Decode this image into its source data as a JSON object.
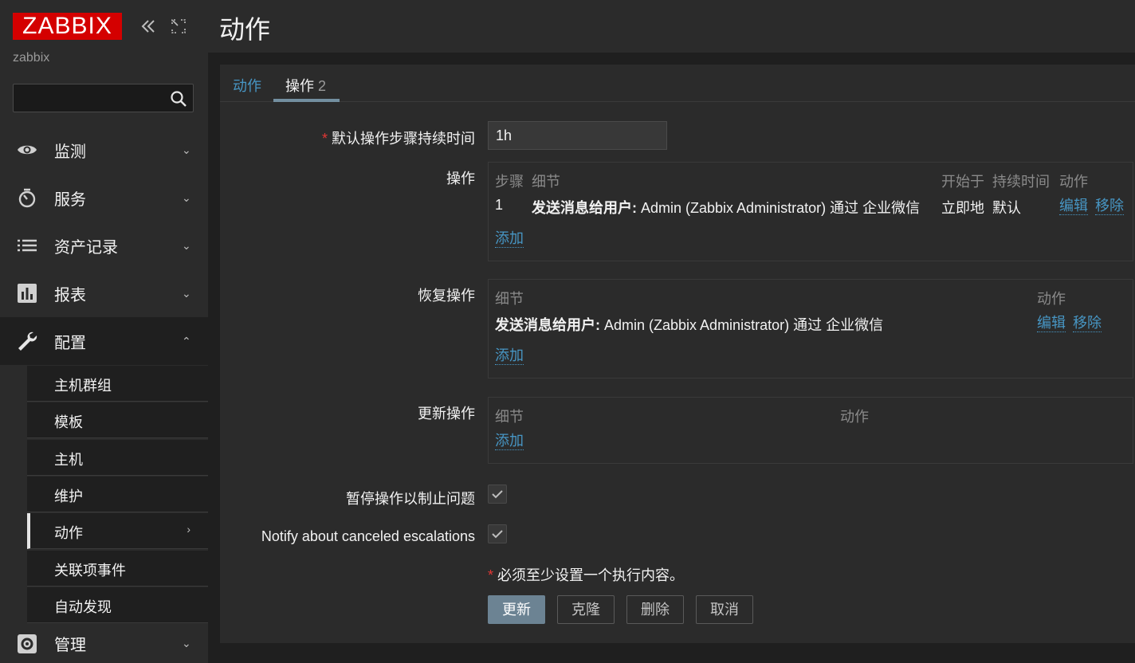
{
  "sidebar": {
    "logo": "ZABBIX",
    "server_name": "zabbix",
    "collapse_icon": "double-chevron-left-icon",
    "kiosk_icon": "expand-icon",
    "search": {
      "value": "",
      "placeholder": ""
    },
    "nav": [
      {
        "label": "监测",
        "icon": "eye-icon"
      },
      {
        "label": "服务",
        "icon": "stopwatch-icon"
      },
      {
        "label": "资产记录",
        "icon": "list-icon"
      },
      {
        "label": "报表",
        "icon": "bar-chart-icon"
      },
      {
        "label": "配置",
        "icon": "wrench-icon"
      },
      {
        "label": "管理",
        "icon": "gear-icon"
      }
    ],
    "config_sub": [
      "主机群组",
      "模板",
      "主机",
      "维护",
      "动作",
      "关联项事件",
      "自动发现"
    ]
  },
  "header": {
    "title": "动作"
  },
  "tabs": [
    {
      "label": "动作"
    },
    {
      "label": "操作",
      "count": "2"
    }
  ],
  "form": {
    "step_duration": {
      "label": "默认操作步骤持续时间",
      "value": "1h"
    },
    "operations": {
      "label": "操作",
      "headers": [
        "步骤",
        "细节",
        "开始于",
        "持续时间",
        "动作"
      ],
      "rows": [
        {
          "step": "1",
          "detail_bold": "发送消息给用户:",
          "detail": " Admin (Zabbix Administrator) 通过 企业微信",
          "start": "立即地",
          "duration": "默认",
          "edit": "编辑",
          "remove": "移除"
        }
      ],
      "add": "添加"
    },
    "recovery": {
      "label": "恢复操作",
      "headers": [
        "细节",
        "动作"
      ],
      "rows": [
        {
          "detail_bold": "发送消息给用户:",
          "detail": " Admin (Zabbix Administrator) 通过 企业微信",
          "edit": "编辑",
          "remove": "移除"
        }
      ],
      "add": "添加"
    },
    "update": {
      "label": "更新操作",
      "headers": [
        "细节",
        "动作"
      ],
      "add": "添加"
    },
    "pause_label": "暂停操作以制止问题",
    "pause_checked": true,
    "notify_label": "Notify about canceled escalations",
    "notify_checked": true,
    "required_note": "必须至少设置一个执行内容。",
    "buttons": {
      "update": "更新",
      "clone": "克隆",
      "delete": "删除",
      "cancel": "取消"
    }
  },
  "colors": {
    "logo": "#d40000",
    "link": "#4796c4",
    "primary_button": "#6c8393",
    "required": "#e33734"
  }
}
